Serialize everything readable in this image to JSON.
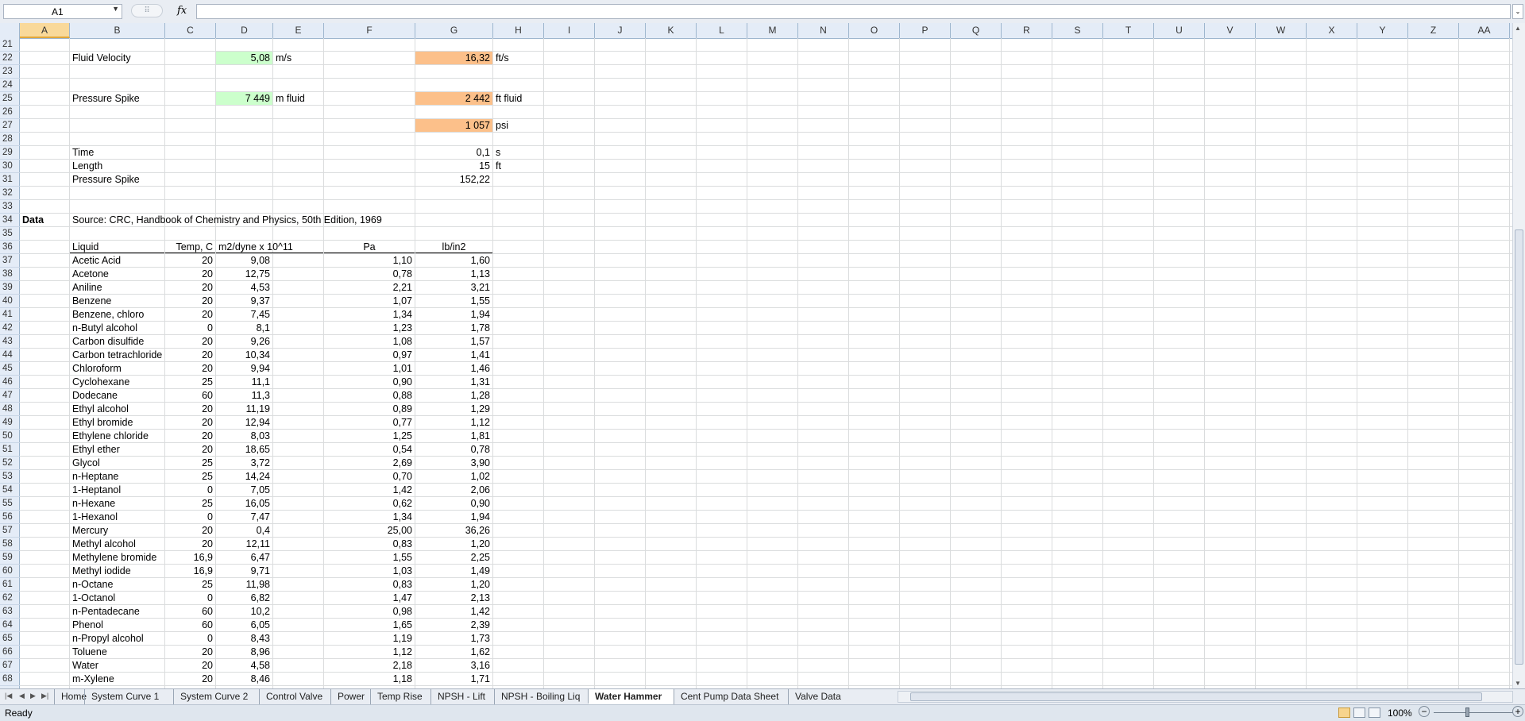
{
  "formula_bar": {
    "name_box": "A1",
    "fx": "fx",
    "formula": ""
  },
  "columns": [
    "A",
    "B",
    "C",
    "D",
    "E",
    "F",
    "G",
    "H",
    "I",
    "J",
    "K",
    "L",
    "M",
    "N",
    "O",
    "P",
    "Q",
    "R",
    "S",
    "T",
    "U",
    "V",
    "W",
    "X",
    "Y",
    "Z",
    "AA"
  ],
  "rows": [
    "21",
    "22",
    "23",
    "24",
    "25",
    "26",
    "27",
    "28",
    "29",
    "30",
    "31",
    "32",
    "33",
    "34",
    "35",
    "36",
    "37",
    "38",
    "39",
    "40",
    "41",
    "42",
    "43",
    "44",
    "45",
    "46",
    "47",
    "48",
    "49",
    "50",
    "51",
    "52",
    "53",
    "54",
    "55",
    "56",
    "57",
    "58",
    "59",
    "60",
    "61",
    "62",
    "63",
    "64",
    "65",
    "66",
    "67",
    "68"
  ],
  "summary": {
    "fluid_velocity": {
      "label": "Fluid Velocity",
      "si_value": "5,08",
      "si_unit": "m/s",
      "us_value": "16,32",
      "us_unit": "ft/s"
    },
    "pressure_spike": {
      "label": "Pressure Spike",
      "si_value": "7 449",
      "si_unit": "m fluid",
      "us_value": "2 442",
      "us_unit": "ft fluid"
    },
    "psi": {
      "value": "1 057",
      "unit": "psi"
    },
    "time": {
      "label": "Time",
      "value": "0,1",
      "unit": "s"
    },
    "length": {
      "label": "Length",
      "value": "15",
      "unit": "ft"
    },
    "spike2": {
      "label": "Pressure Spike",
      "value": "152,22"
    }
  },
  "data_section": {
    "label": "Data",
    "source": "Source: CRC, Handbook of Chemistry and Physics, 50th Edition, 1969",
    "headers": [
      "Liquid",
      "Temp, C",
      "m2/dyne x 10^11",
      "Pa",
      "lb/in2"
    ],
    "rows": [
      [
        "Acetic Acid",
        "20",
        "9,08",
        "1,10",
        "1,60"
      ],
      [
        "Acetone",
        "20",
        "12,75",
        "0,78",
        "1,13"
      ],
      [
        "Aniline",
        "20",
        "4,53",
        "2,21",
        "3,21"
      ],
      [
        "Benzene",
        "20",
        "9,37",
        "1,07",
        "1,55"
      ],
      [
        "Benzene, chloro",
        "20",
        "7,45",
        "1,34",
        "1,94"
      ],
      [
        "n-Butyl alcohol",
        "0",
        "8,1",
        "1,23",
        "1,78"
      ],
      [
        "Carbon disulfide",
        "20",
        "9,26",
        "1,08",
        "1,57"
      ],
      [
        "Carbon tetrachloride",
        "20",
        "10,34",
        "0,97",
        "1,41"
      ],
      [
        "Chloroform",
        "20",
        "9,94",
        "1,01",
        "1,46"
      ],
      [
        "Cyclohexane",
        "25",
        "11,1",
        "0,90",
        "1,31"
      ],
      [
        "Dodecane",
        "60",
        "11,3",
        "0,88",
        "1,28"
      ],
      [
        "Ethyl alcohol",
        "20",
        "11,19",
        "0,89",
        "1,29"
      ],
      [
        "Ethyl bromide",
        "20",
        "12,94",
        "0,77",
        "1,12"
      ],
      [
        "Ethylene chloride",
        "20",
        "8,03",
        "1,25",
        "1,81"
      ],
      [
        "Ethyl ether",
        "20",
        "18,65",
        "0,54",
        "0,78"
      ],
      [
        "Glycol",
        "25",
        "3,72",
        "2,69",
        "3,90"
      ],
      [
        "n-Heptane",
        "25",
        "14,24",
        "0,70",
        "1,02"
      ],
      [
        "1-Heptanol",
        "0",
        "7,05",
        "1,42",
        "2,06"
      ],
      [
        "n-Hexane",
        "25",
        "16,05",
        "0,62",
        "0,90"
      ],
      [
        "1-Hexanol",
        "0",
        "7,47",
        "1,34",
        "1,94"
      ],
      [
        "Mercury",
        "20",
        "0,4",
        "25,00",
        "36,26"
      ],
      [
        "Methyl alcohol",
        "20",
        "12,11",
        "0,83",
        "1,20"
      ],
      [
        "Methylene bromide",
        "16,9",
        "6,47",
        "1,55",
        "2,25"
      ],
      [
        "Methyl iodide",
        "16,9",
        "9,71",
        "1,03",
        "1,49"
      ],
      [
        "n-Octane",
        "25",
        "11,98",
        "0,83",
        "1,20"
      ],
      [
        "1-Octanol",
        "0",
        "6,82",
        "1,47",
        "2,13"
      ],
      [
        "n-Pentadecane",
        "60",
        "10,2",
        "0,98",
        "1,42"
      ],
      [
        "Phenol",
        "60",
        "6,05",
        "1,65",
        "2,39"
      ],
      [
        "n-Propyl alcohol",
        "0",
        "8,43",
        "1,19",
        "1,73"
      ],
      [
        "Toluene",
        "20",
        "8,96",
        "1,12",
        "1,62"
      ],
      [
        "Water",
        "20",
        "4,58",
        "2,18",
        "3,16"
      ],
      [
        "m-Xylene",
        "20",
        "8,46",
        "1,18",
        "1,71"
      ]
    ]
  },
  "tabs": [
    "Home",
    "System Curve 1",
    "System Curve 2",
    "Control Valve",
    "Power",
    "Temp Rise",
    "NPSH - Lift",
    "NPSH - Boiling Liq",
    "Water Hammer",
    "Cent Pump Data Sheet",
    "Valve Data"
  ],
  "active_tab": "Water Hammer",
  "status": {
    "text": "Ready",
    "zoom": "100%"
  }
}
